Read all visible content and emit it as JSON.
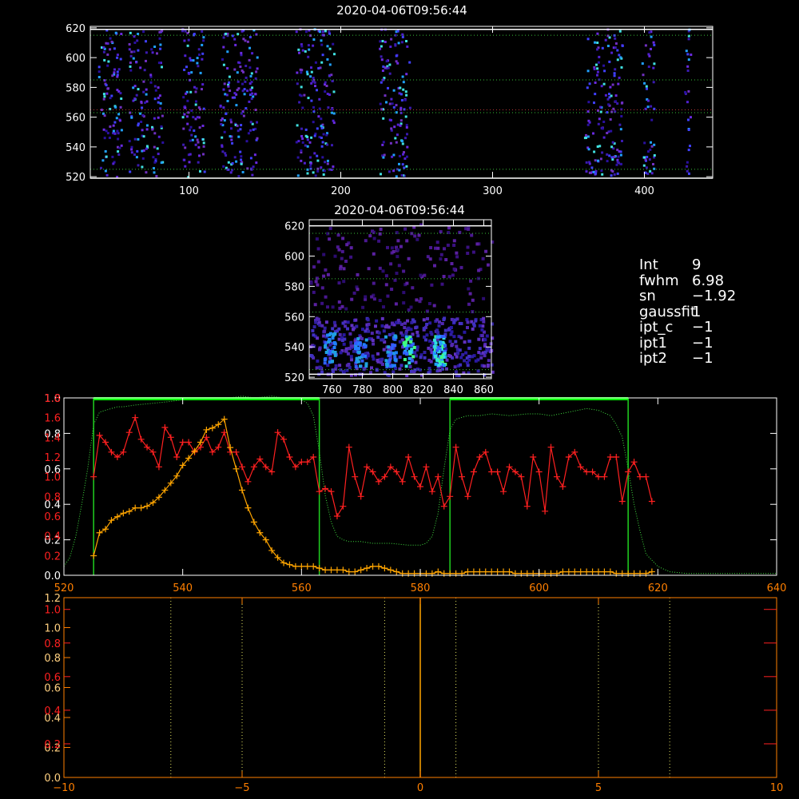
{
  "colors": {
    "background": "#000000",
    "axes": "#ffffff",
    "dotted_green": "#39c039",
    "dotted_red": "#c03939",
    "red_series": "#ff2020",
    "orange_series": "#ffa500",
    "green_markers": "#00e000",
    "bright_green_bar": "#00ff00",
    "orange_axis": "#ff7f00",
    "red_axis": "#ff2020"
  },
  "top_panel": {
    "title": "2020-04-06T09:56:44",
    "y_ticks": [
      "520",
      "540",
      "560",
      "580",
      "600",
      "620"
    ],
    "x_ticks": [
      "100",
      "200",
      "300",
      "400"
    ]
  },
  "mid_panel": {
    "title": "2020-04-06T09:56:44",
    "y_ticks": [
      "520",
      "540",
      "560",
      "580",
      "600",
      "620"
    ],
    "x_ticks": [
      "760",
      "780",
      "800",
      "820",
      "840",
      "860"
    ]
  },
  "info": [
    {
      "key": "Int",
      "value": "9"
    },
    {
      "key": "fwhm",
      "value": "6.98"
    },
    {
      "key": "sn",
      "value": "−1.92"
    },
    {
      "key": "gaussfit",
      "value": "1"
    },
    {
      "key": "ipt_c",
      "value": "−1"
    },
    {
      "key": "ipt1",
      "value": "−1"
    },
    {
      "key": "ipt2",
      "value": "−1"
    }
  ],
  "chart_data": [
    {
      "type": "heatmap",
      "title": "2020-04-06T09:56:44",
      "xlim": [
        35,
        445
      ],
      "ylim": [
        519,
        621
      ],
      "x_ticks": [
        100,
        200,
        300,
        400
      ],
      "y_ticks": [
        520,
        540,
        560,
        580,
        600,
        620
      ],
      "hlines_solid": [
        519,
        619
      ],
      "hlines_dotted_green": [
        525,
        563,
        585,
        615
      ],
      "hlines_dotted_red": [
        565
      ],
      "active_columns": [
        [
          40,
          55
        ],
        [
          60,
          72
        ],
        [
          74,
          82
        ],
        [
          95,
          110
        ],
        [
          120,
          145
        ],
        [
          170,
          195
        ],
        [
          225,
          245
        ],
        [
          360,
          385
        ],
        [
          398,
          406
        ],
        [
          426,
          430
        ]
      ]
    },
    {
      "type": "heatmap",
      "title": "2020-04-06T09:56:44",
      "xlim": [
        745,
        865
      ],
      "ylim": [
        519,
        624
      ],
      "x_ticks": [
        760,
        780,
        800,
        820,
        840,
        860
      ],
      "y_ticks": [
        520,
        540,
        560,
        580,
        600,
        620
      ],
      "hlines_solid": [
        522,
        620
      ],
      "hlines_dotted_green": [
        525,
        563,
        585,
        615
      ],
      "hot_spots": [
        [
          758,
          540
        ],
        [
          778,
          538
        ],
        [
          798,
          538
        ],
        [
          810,
          538
        ],
        [
          830,
          538
        ]
      ]
    },
    {
      "type": "line",
      "xlim": [
        520,
        640
      ],
      "left_axis_white": {
        "ylim": [
          0,
          1.0
        ],
        "ticks": [
          0.0,
          0.2,
          0.4,
          0.6,
          0.8,
          1.0
        ],
        "labels": [
          "0.0",
          "0.2",
          "0.4",
          "0.6",
          "0.8",
          "1.0"
        ]
      },
      "left_axis_red": {
        "ylim": [
          0,
          1.8
        ],
        "ticks": [
          0.2,
          0.4,
          0.6,
          0.8,
          1.0,
          1.2,
          1.4,
          1.6,
          1.8
        ],
        "labels": [
          "0.2",
          "0.4",
          "0.6",
          "0.8",
          "1.0",
          "1.2",
          "1.4",
          "1.6",
          "1.8"
        ]
      },
      "x_ticks": [
        520,
        540,
        560,
        580,
        600,
        620,
        640
      ],
      "vlines_green": [
        525,
        563,
        585,
        615
      ],
      "green_bars": [
        [
          525,
          563
        ],
        [
          585,
          615
        ]
      ],
      "series": [
        {
          "color": "red",
          "x": [
            525,
            526,
            527,
            528,
            529,
            530,
            531,
            532,
            533,
            534,
            535,
            536,
            537,
            538,
            539,
            540,
            541,
            542,
            543,
            544,
            545,
            546,
            547,
            548,
            549,
            550,
            551,
            552,
            553,
            554,
            555,
            556,
            557,
            558,
            559,
            560,
            561,
            562,
            563,
            564,
            565,
            566,
            567,
            568,
            569,
            570,
            571,
            572,
            573,
            574,
            575,
            576,
            577,
            578,
            579,
            580,
            581,
            582,
            583,
            584,
            585,
            586,
            587,
            588,
            589,
            590,
            591,
            592,
            593,
            594,
            595,
            596,
            597,
            598,
            599,
            600,
            601,
            602,
            603,
            604,
            605,
            606,
            607,
            608,
            609,
            610,
            611,
            612,
            613,
            614,
            615,
            616,
            617,
            618,
            619
          ],
          "y": [
            1.0,
            1.42,
            1.35,
            1.25,
            1.2,
            1.25,
            1.45,
            1.6,
            1.38,
            1.3,
            1.25,
            1.1,
            1.5,
            1.4,
            1.2,
            1.35,
            1.35,
            1.25,
            1.3,
            1.4,
            1.25,
            1.3,
            1.45,
            1.25,
            1.25,
            1.1,
            0.95,
            1.1,
            1.18,
            1.1,
            1.05,
            1.45,
            1.38,
            1.2,
            1.1,
            1.15,
            1.15,
            1.2,
            0.85,
            0.88,
            0.85,
            0.6,
            0.7,
            1.3,
            1.0,
            0.8,
            1.1,
            1.05,
            0.95,
            1.0,
            1.1,
            1.05,
            0.95,
            1.2,
            1.0,
            0.9,
            1.1,
            0.85,
            1.0,
            0.7,
            0.8,
            1.3,
            1.0,
            0.8,
            1.05,
            1.2,
            1.25,
            1.05,
            1.05,
            0.85,
            1.1,
            1.05,
            1.0,
            0.7,
            1.2,
            1.05,
            0.65,
            1.3,
            1.0,
            0.9,
            1.2,
            1.25,
            1.1,
            1.05,
            1.05,
            1.0,
            1.0,
            1.2,
            1.2,
            0.75,
            1.05,
            1.15,
            1.0,
            1.0,
            0.75
          ]
        },
        {
          "color": "orange",
          "x": [
            525,
            526,
            527,
            528,
            529,
            530,
            531,
            532,
            533,
            534,
            535,
            536,
            537,
            538,
            539,
            540,
            541,
            542,
            543,
            544,
            545,
            546,
            547,
            548,
            549,
            550,
            551,
            552,
            553,
            554,
            555,
            556,
            557,
            558,
            559,
            560,
            561,
            562,
            563,
            564,
            565,
            566,
            567,
            568,
            569,
            570,
            571,
            572,
            573,
            574,
            575,
            576,
            577,
            578,
            579,
            580,
            581,
            582,
            583,
            584,
            585,
            586,
            587,
            588,
            589,
            590,
            591,
            592,
            593,
            594,
            595,
            596,
            597,
            598,
            599,
            600,
            601,
            602,
            603,
            604,
            605,
            606,
            607,
            608,
            609,
            610,
            611,
            612,
            613,
            614,
            615,
            616,
            617,
            618,
            619
          ],
          "y": [
            0.11,
            0.24,
            0.26,
            0.31,
            0.33,
            0.35,
            0.36,
            0.38,
            0.38,
            0.39,
            0.41,
            0.44,
            0.48,
            0.52,
            0.56,
            0.62,
            0.66,
            0.7,
            0.75,
            0.82,
            0.83,
            0.85,
            0.88,
            0.72,
            0.6,
            0.48,
            0.38,
            0.3,
            0.24,
            0.2,
            0.14,
            0.1,
            0.07,
            0.06,
            0.05,
            0.05,
            0.05,
            0.05,
            0.04,
            0.03,
            0.03,
            0.03,
            0.03,
            0.02,
            0.02,
            0.03,
            0.04,
            0.05,
            0.05,
            0.04,
            0.03,
            0.02,
            0.01,
            0.01,
            0.01,
            0.01,
            0.01,
            0.01,
            0.02,
            0.01,
            0.01,
            0.01,
            0.01,
            0.02,
            0.02,
            0.02,
            0.02,
            0.02,
            0.02,
            0.02,
            0.02,
            0.01,
            0.01,
            0.01,
            0.01,
            0.01,
            0.01,
            0.01,
            0.01,
            0.02,
            0.02,
            0.02,
            0.02,
            0.02,
            0.02,
            0.02,
            0.02,
            0.02,
            0.01,
            0.01,
            0.01,
            0.01,
            0.01,
            0.01,
            0.02
          ]
        },
        {
          "color": "green-dotted",
          "x": [
            520,
            521,
            522,
            523,
            524,
            525,
            526,
            527,
            528,
            529,
            530,
            532,
            535,
            538,
            540,
            542,
            545,
            548,
            550,
            552,
            555,
            557,
            559,
            560,
            561,
            562,
            563,
            564,
            565,
            566,
            567,
            568,
            570,
            572,
            575,
            578,
            580,
            581,
            582,
            583,
            584,
            585,
            586,
            588,
            590,
            592,
            595,
            598,
            600,
            602,
            605,
            608,
            610,
            612,
            613,
            614,
            615,
            616,
            617,
            618,
            620,
            622,
            625,
            630,
            635,
            640
          ],
          "y": [
            0.05,
            0.1,
            0.22,
            0.4,
            0.6,
            0.85,
            0.92,
            0.93,
            0.94,
            0.95,
            0.95,
            0.96,
            0.97,
            0.98,
            0.99,
            1.0,
            1.0,
            1.0,
            1.01,
            1.0,
            1.01,
            1.0,
            1.0,
            0.99,
            0.97,
            0.9,
            0.7,
            0.45,
            0.3,
            0.22,
            0.2,
            0.19,
            0.19,
            0.18,
            0.18,
            0.17,
            0.17,
            0.18,
            0.22,
            0.35,
            0.6,
            0.82,
            0.88,
            0.9,
            0.9,
            0.91,
            0.9,
            0.91,
            0.91,
            0.9,
            0.92,
            0.94,
            0.93,
            0.9,
            0.85,
            0.78,
            0.6,
            0.4,
            0.25,
            0.12,
            0.05,
            0.02,
            0.01,
            0.01,
            0.01,
            0.01
          ]
        }
      ]
    },
    {
      "type": "line",
      "xlim": [
        -10,
        10
      ],
      "left_axis_white": {
        "ylim": [
          0,
          1.2
        ],
        "labels": [
          "0.0",
          "0.2",
          "0.4",
          "0.6",
          "0.8",
          "1.0",
          "1.2"
        ]
      },
      "left_axis_red": {
        "labels": [
          "0.2",
          "0.4",
          "0.6",
          "0.8",
          "1.0"
        ]
      },
      "x_ticks": [
        -10,
        -5,
        0,
        5,
        10
      ],
      "x_tick_labels": [
        "−10",
        "−5",
        "0",
        "5",
        "10"
      ],
      "vlines_dotted": [
        -7,
        -5,
        -1,
        1,
        5,
        7
      ],
      "vline_orange": [
        0
      ]
    }
  ]
}
